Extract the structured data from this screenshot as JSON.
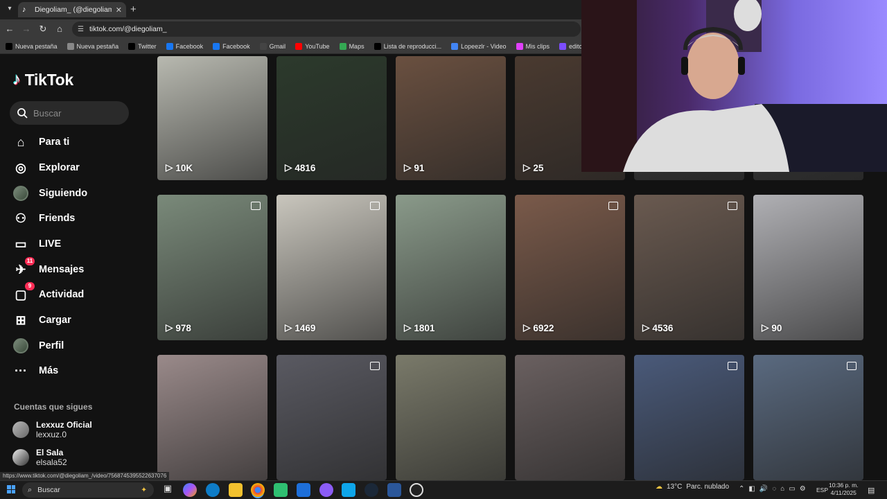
{
  "browser": {
    "tab_title": "Diegoliam_ (@diegoliam_) | TikTok",
    "new_tab_symbol": "+",
    "url": "tiktok.com/@diegoliam_",
    "status_url": "https://www.tiktok.com/@diegoliam_/video/7568745395522637076",
    "bookmarks": [
      {
        "label": "Nueva pestaña",
        "icon": "tiktok-icon",
        "color": "#000000"
      },
      {
        "label": "Nueva pestaña",
        "icon": "globe-icon",
        "color": "#888888"
      },
      {
        "label": "Twitter",
        "icon": "x-icon",
        "color": "#000000"
      },
      {
        "label": "Facebook",
        "icon": "facebook-icon",
        "color": "#1877f2"
      },
      {
        "label": "Facebook",
        "icon": "facebook-icon",
        "color": "#1877f2"
      },
      {
        "label": "Gmail",
        "icon": "gmail-icon",
        "color": "#444444"
      },
      {
        "label": "YouTube",
        "icon": "youtube-icon",
        "color": "#ff0000"
      },
      {
        "label": "Maps",
        "icon": "maps-icon",
        "color": "#34a853"
      },
      {
        "label": "Lista de reproducci...",
        "icon": "tiktok-icon",
        "color": "#000000"
      },
      {
        "label": "Lopeezlr - Video",
        "icon": "chrome-icon",
        "color": "#4285f4"
      },
      {
        "label": "Mis clips",
        "icon": "clips-icon",
        "color": "#e040fb"
      },
      {
        "label": "editor de videos onl...",
        "icon": "editor-icon",
        "color": "#7c4dff"
      },
      {
        "label": "",
        "icon": "px-icon",
        "color": "#2e7d32"
      }
    ]
  },
  "sidebar": {
    "logo": "TikTok",
    "search_placeholder": "Buscar",
    "nav": [
      {
        "label": "Para ti",
        "icon": "home-icon"
      },
      {
        "label": "Explorar",
        "icon": "compass-icon"
      },
      {
        "label": "Siguiendo",
        "icon": "following-avatar-icon"
      },
      {
        "label": "Friends",
        "icon": "friends-icon"
      },
      {
        "label": "LIVE",
        "icon": "live-icon"
      },
      {
        "label": "Mensajes",
        "icon": "messages-icon",
        "badge": "11"
      },
      {
        "label": "Actividad",
        "icon": "activity-icon",
        "badge": "9"
      },
      {
        "label": "Cargar",
        "icon": "upload-icon"
      },
      {
        "label": "Perfil",
        "icon": "profile-avatar-icon"
      },
      {
        "label": "Más",
        "icon": "more-icon"
      }
    ],
    "following_title": "Cuentas que sigues",
    "accounts": [
      {
        "name": "Lexxuz Oficial",
        "handle": "lexxuz.0"
      },
      {
        "name": "El Sala",
        "handle": "elsala52"
      }
    ]
  },
  "videos": [
    {
      "views": "10K",
      "bg": "#b8b9b0",
      "photo": false
    },
    {
      "views": "4816",
      "bg": "#2c3a2c",
      "photo": false
    },
    {
      "views": "91",
      "bg": "#6a5040",
      "photo": false
    },
    {
      "views": "25",
      "bg": "#4a3a30",
      "photo": false
    },
    {
      "views": "",
      "bg": "#3a3a3a",
      "photo": false
    },
    {
      "views": "",
      "bg": "#3a3a3a",
      "photo": false
    },
    {
      "views": "978",
      "bg": "#7a8a7a",
      "photo": true
    },
    {
      "views": "1469",
      "bg": "#c9c6bd",
      "photo": true
    },
    {
      "views": "1801",
      "bg": "#8a9a8a",
      "photo": false
    },
    {
      "views": "6922",
      "bg": "#7a5a4a",
      "photo": true
    },
    {
      "views": "4536",
      "bg": "#6a5a50",
      "photo": true
    },
    {
      "views": "90",
      "bg": "#b0b0b4",
      "photo": false
    },
    {
      "views": "",
      "bg": "#9a8a8a",
      "photo": false
    },
    {
      "views": "",
      "bg": "#5a5a62",
      "photo": true
    },
    {
      "views": "",
      "bg": "#7a7a6a",
      "photo": false
    },
    {
      "views": "",
      "bg": "#6a6060",
      "photo": false
    },
    {
      "views": "",
      "bg": "#4a5a7a",
      "photo": true
    },
    {
      "views": "",
      "bg": "#5a6a80",
      "photo": true
    }
  ],
  "taskbar": {
    "search_label": "Buscar",
    "weather_temp": "13°C",
    "weather_desc": "Parc. nublado",
    "lang": "ESP",
    "time": "10:36 p. m.",
    "date": "4/11/2025"
  }
}
